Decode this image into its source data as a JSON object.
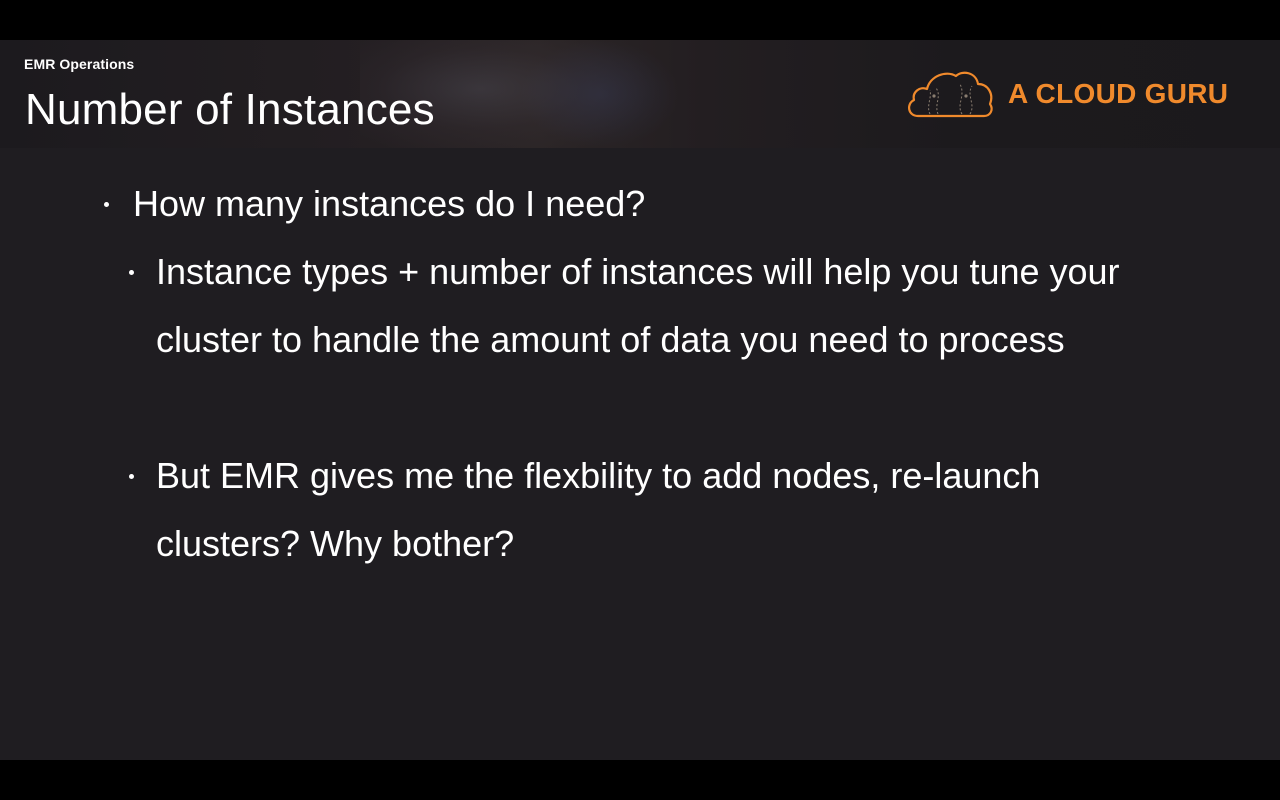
{
  "header": {
    "course_label": "EMR Operations",
    "title": "Number of Instances",
    "logo_text": "A CLOUD GURU",
    "logo_icon": "cloud-icon",
    "logo_color": "#f08a2c"
  },
  "bullets": [
    {
      "level": 1,
      "text": "How many instances do I need?"
    },
    {
      "level": 2,
      "text": "Instance types + number of instances will help you tune your cluster to handle the amount of data you need to process"
    },
    {
      "level": 2,
      "text": "But EMR gives me the flexbility to add nodes, re-launch clusters?  Why bother?"
    }
  ],
  "colors": {
    "slide_background": "#1f1d21",
    "text": "#ffffff",
    "accent": "#f08a2c"
  }
}
